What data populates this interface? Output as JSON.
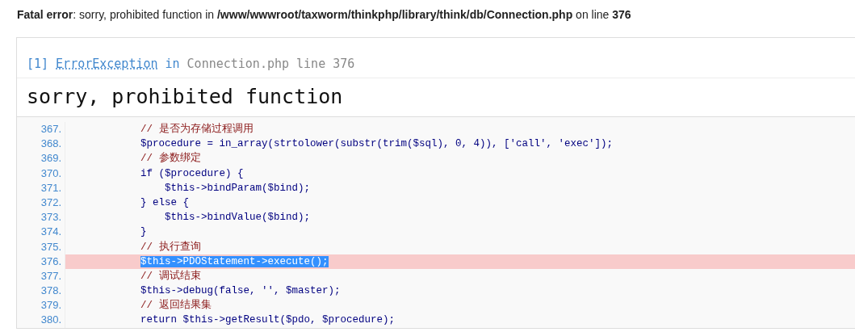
{
  "fatal_message": "**Fatal error**: sorry, prohibited function in **/www/wwwroot/taxworm/thinkphp/library/think/db/Connection.php** on line **376**",
  "exception": {
    "index": "[1]",
    "class": "ErrorException",
    "in": "in",
    "location": "Connection.php line 376"
  },
  "message": "sorry, prohibited function",
  "code_lines": [
    {
      "number": "367.",
      "kind": "comment",
      "text": "            // 是否为存储过程调用",
      "highlighted": false
    },
    {
      "number": "368.",
      "kind": "code",
      "text": "            $procedure = in_array(strtolower(substr(trim($sql), 0, 4)), ['call', 'exec']);",
      "highlighted": false
    },
    {
      "number": "369.",
      "kind": "comment",
      "text": "            // 参数绑定",
      "highlighted": false
    },
    {
      "number": "370.",
      "kind": "code",
      "text": "            if ($procedure) {",
      "highlighted": false
    },
    {
      "number": "371.",
      "kind": "code",
      "text": "                $this->bindParam($bind);",
      "highlighted": false
    },
    {
      "number": "372.",
      "kind": "code",
      "text": "            } else {",
      "highlighted": false
    },
    {
      "number": "373.",
      "kind": "code",
      "text": "                $this->bindValue($bind);",
      "highlighted": false
    },
    {
      "number": "374.",
      "kind": "code",
      "text": "            }",
      "highlighted": false
    },
    {
      "number": "375.",
      "kind": "comment",
      "text": "            // 执行查询",
      "highlighted": false
    },
    {
      "number": "376.",
      "kind": "code",
      "text": "            $this->PDOStatement->execute();",
      "highlighted": true
    },
    {
      "number": "377.",
      "kind": "comment",
      "text": "            // 调试结束",
      "highlighted": false
    },
    {
      "number": "378.",
      "kind": "code",
      "text": "            $this->debug(false, '', $master);",
      "highlighted": false
    },
    {
      "number": "379.",
      "kind": "comment",
      "text": "            // 返回结果集",
      "highlighted": false
    },
    {
      "number": "380.",
      "kind": "code",
      "text": "            return $this->getResult($pdo, $procedure);",
      "highlighted": false
    }
  ]
}
